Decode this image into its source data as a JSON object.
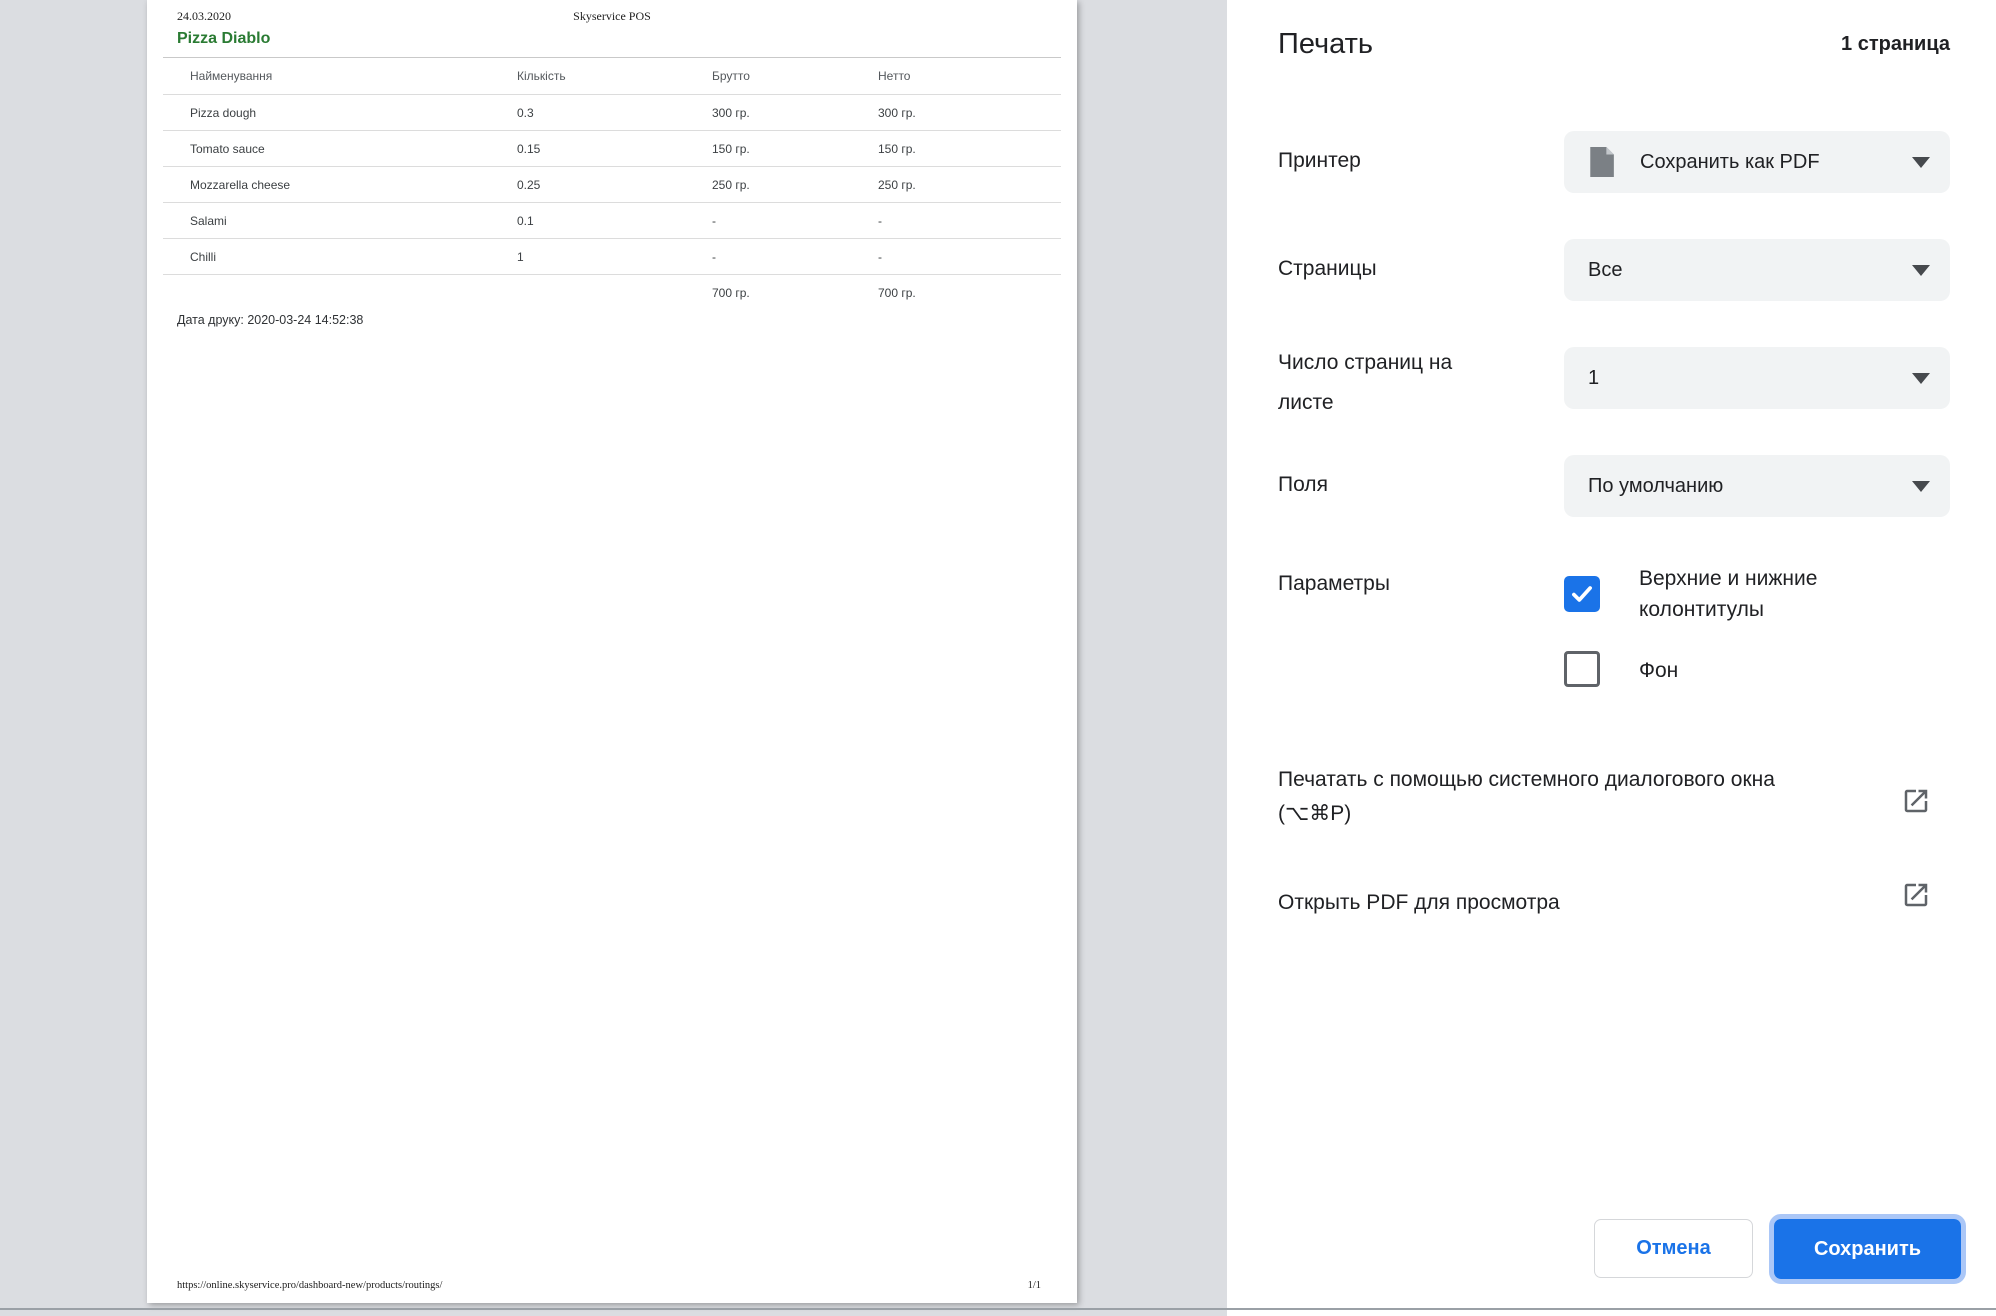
{
  "accent_color": "#1a73e8",
  "preview_page": {
    "header_date": "24.03.2020",
    "header_app": "Skyservice POS",
    "title": "Pizza Diablo",
    "title_color": "#2a7b33",
    "table": {
      "headers": [
        "Найменування",
        "Кількість",
        "Брутто",
        "Нетто"
      ],
      "rows": [
        {
          "name": "Pizza dough",
          "qty": "0.3",
          "brutto": "300 гр.",
          "netto": "300 гр."
        },
        {
          "name": "Tomato sauce",
          "qty": "0.15",
          "brutto": "150 гр.",
          "netto": "150 гр."
        },
        {
          "name": "Mozzarella cheese",
          "qty": "0.25",
          "brutto": "250 гр.",
          "netto": "250 гр."
        },
        {
          "name": "Salami",
          "qty": "0.1",
          "brutto": "-",
          "netto": "-"
        },
        {
          "name": "Chilli",
          "qty": "1",
          "brutto": "-",
          "netto": "-"
        }
      ],
      "total_brutto": "700 гр.",
      "total_netto": "700 гр."
    },
    "print_date": "Дата друку: 2020-03-24 14:52:38",
    "footer_url": "https://online.skyservice.pro/dashboard-new/products/routings/",
    "footer_page": "1/1"
  },
  "dialog": {
    "title": "Печать",
    "sheet_count": "1 страница",
    "printer": {
      "label": "Принтер",
      "value": "Сохранить как PDF"
    },
    "pages": {
      "label": "Страницы",
      "value": "Все"
    },
    "pages_per_sheet": {
      "label": "Число страниц на листе",
      "value": "1"
    },
    "margins": {
      "label": "Поля",
      "value": "По умолчанию"
    },
    "options": {
      "label": "Параметры",
      "checkboxes": [
        {
          "label": "Верхние и нижние колонтитулы",
          "checked": true
        },
        {
          "label": "Фон",
          "checked": false
        }
      ]
    },
    "links": [
      {
        "label": "Печатать с помощью системного диалогового окна (⌥⌘P)"
      },
      {
        "label": "Открыть PDF для просмотра"
      }
    ],
    "cancel_label": "Отмена",
    "save_label": "Сохранить"
  }
}
